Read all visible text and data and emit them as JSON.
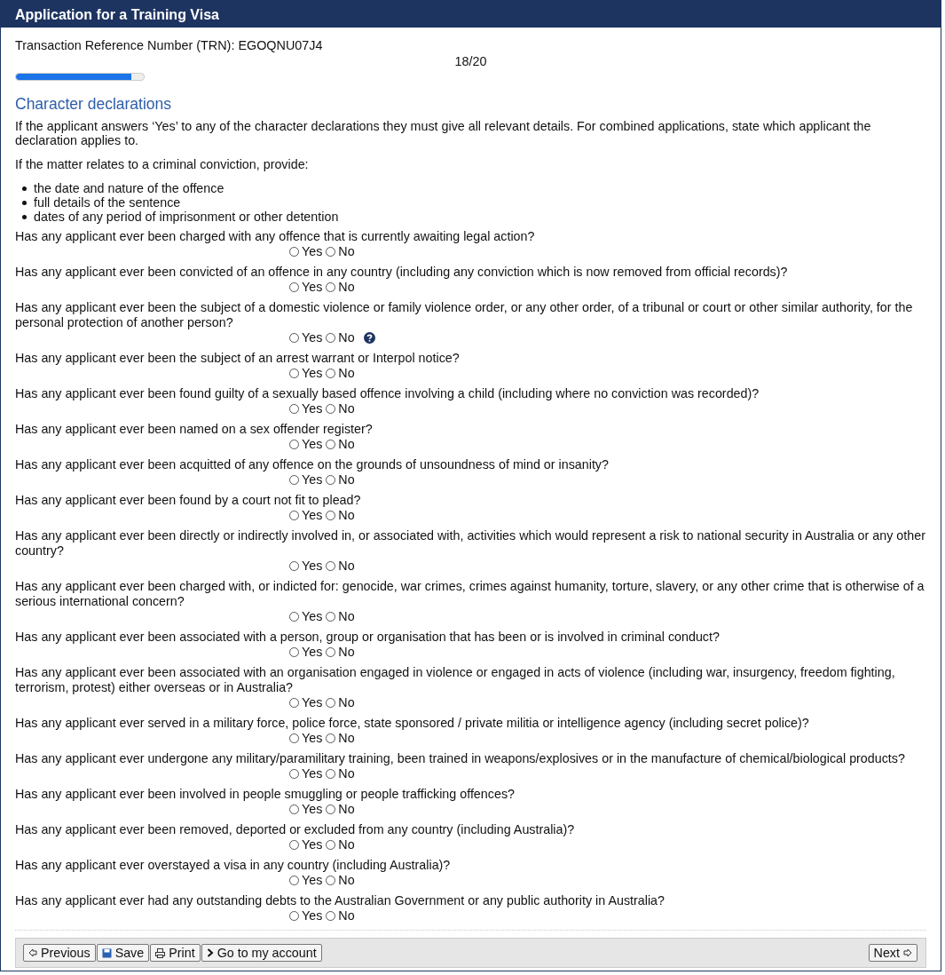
{
  "window": {
    "title": "Application for a Training Visa"
  },
  "trn": "Transaction Reference Number (TRN): EGOQNU07J4",
  "progress": {
    "label": "18/20",
    "level": 0.9
  },
  "section": {
    "title": "Character declarations",
    "intro": [
      "If the applicant answers ‘Yes’ to any of the character declarations they must give all relevant details. For combined applications, state which applicant the declaration applies to.",
      "If the matter relates to a criminal conviction, provide:"
    ],
    "bullets": [
      "the date and nature of the offence",
      "full details of the sentence",
      "dates of any period of imprisonment or other detention"
    ]
  },
  "questions": [
    {
      "text": "Has any applicant ever been charged with any offence that is currently awaiting legal action?",
      "options": [
        {
          "label": "Yes",
          "selected": false
        },
        {
          "label": "No",
          "selected": false
        }
      ],
      "help": false
    },
    {
      "text": "Has any applicant ever been convicted of an offence in any country (including any conviction which is now removed from official records)?",
      "options": [
        {
          "label": "Yes",
          "selected": false
        },
        {
          "label": "No",
          "selected": false
        }
      ],
      "help": false
    },
    {
      "text": "Has any applicant ever been the subject of a domestic violence or family violence order, or any other order, of a tribunal or court or other similar authority, for the personal protection of another person?",
      "options": [
        {
          "label": "Yes",
          "selected": false
        },
        {
          "label": "No",
          "selected": false
        }
      ],
      "help": true
    },
    {
      "text": "Has any applicant ever been the subject of an arrest warrant or Interpol notice?",
      "options": [
        {
          "label": "Yes",
          "selected": false
        },
        {
          "label": "No",
          "selected": false
        }
      ],
      "help": false
    },
    {
      "text": "Has any applicant ever been found guilty of a sexually based offence involving a child (including where no conviction was recorded)?",
      "options": [
        {
          "label": "Yes",
          "selected": false
        },
        {
          "label": "No",
          "selected": false
        }
      ],
      "help": false
    },
    {
      "text": "Has any applicant ever been named on a sex offender register?",
      "options": [
        {
          "label": "Yes",
          "selected": false
        },
        {
          "label": "No",
          "selected": false
        }
      ],
      "help": false
    },
    {
      "text": "Has any applicant ever been acquitted of any offence on the grounds of unsoundness of mind or insanity?",
      "options": [
        {
          "label": "Yes",
          "selected": false
        },
        {
          "label": "No",
          "selected": false
        }
      ],
      "help": false
    },
    {
      "text": "Has any applicant ever been found by a court not fit to plead?",
      "options": [
        {
          "label": "Yes",
          "selected": false
        },
        {
          "label": "No",
          "selected": false
        }
      ],
      "help": false
    },
    {
      "text": "Has any applicant ever been directly or indirectly involved in, or associated with, activities which would represent a risk to national security in Australia or any other country?",
      "options": [
        {
          "label": "Yes",
          "selected": false
        },
        {
          "label": "No",
          "selected": false
        }
      ],
      "help": false
    },
    {
      "text": "Has any applicant ever been charged with, or indicted for: genocide, war crimes, crimes against humanity, torture, slavery, or any other crime that is otherwise of a serious international concern?",
      "options": [
        {
          "label": "Yes",
          "selected": false
        },
        {
          "label": "No",
          "selected": false
        }
      ],
      "help": false
    },
    {
      "text": "Has any applicant ever been associated with a person, group or organisation that has been or is involved in criminal conduct?",
      "options": [
        {
          "label": "Yes",
          "selected": false
        },
        {
          "label": "No",
          "selected": false
        }
      ],
      "help": false
    },
    {
      "text": "Has any applicant ever been associated with an organisation engaged in violence or engaged in acts of violence (including war, insurgency, freedom fighting, terrorism, protest) either overseas or in Australia?",
      "options": [
        {
          "label": "Yes",
          "selected": false
        },
        {
          "label": "No",
          "selected": false
        }
      ],
      "help": false
    },
    {
      "text": "Has any applicant ever served in a military force, police force, state sponsored / private militia or intelligence agency (including secret police)?",
      "options": [
        {
          "label": "Yes",
          "selected": false
        },
        {
          "label": "No",
          "selected": false
        }
      ],
      "help": false
    },
    {
      "text": "Has any applicant ever undergone any military/paramilitary training, been trained in weapons/explosives or in the manufacture of chemical/biological products?",
      "options": [
        {
          "label": "Yes",
          "selected": false
        },
        {
          "label": "No",
          "selected": false
        }
      ],
      "help": false
    },
    {
      "text": "Has any applicant ever been involved in people smuggling or people trafficking offences?",
      "options": [
        {
          "label": "Yes",
          "selected": false
        },
        {
          "label": "No",
          "selected": false
        }
      ],
      "help": false
    },
    {
      "text": "Has any applicant ever been removed, deported or excluded from any country (including Australia)?",
      "options": [
        {
          "label": "Yes",
          "selected": false
        },
        {
          "label": "No",
          "selected": false
        }
      ],
      "help": false
    },
    {
      "text": "Has any applicant ever overstayed a visa in any country (including Australia)?",
      "options": [
        {
          "label": "Yes",
          "selected": false
        },
        {
          "label": "No",
          "selected": false
        }
      ],
      "help": false
    },
    {
      "text": "Has any applicant ever had any outstanding debts to the Australian Government or any public authority in Australia?",
      "options": [
        {
          "label": "Yes",
          "selected": false
        },
        {
          "label": "No",
          "selected": false
        }
      ],
      "help": false
    }
  ],
  "footer": {
    "left_buttons": [
      {
        "kind": "previous",
        "label": "Previous"
      },
      {
        "kind": "save",
        "label": "Save"
      },
      {
        "kind": "print",
        "label": "Print"
      },
      {
        "kind": "account",
        "label": "Go to my account"
      }
    ],
    "right_buttons": [
      {
        "kind": "next",
        "label": "Next"
      }
    ]
  }
}
